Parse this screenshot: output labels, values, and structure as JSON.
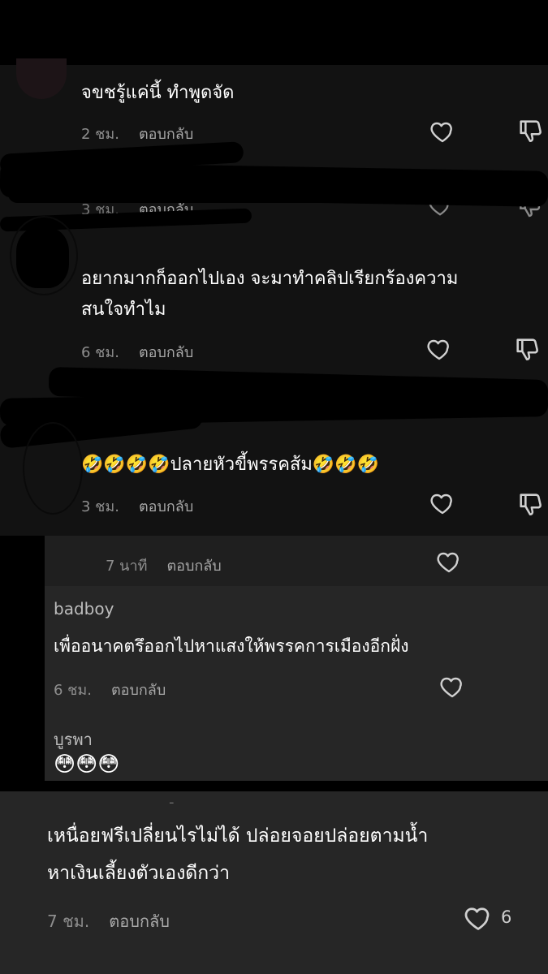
{
  "comments": [
    {
      "text": "จขชรู้แค่นี้ ทำพูดจัด",
      "time": "2 ชม.",
      "reply": "ตอบกลับ"
    },
    {
      "time": "3 ชม.",
      "reply": "ตอบกลับ"
    },
    {
      "lines": [
        "อยากมากก็ออกไปเอง จะมาทำคลิปเรียกร้องความ",
        "สนใจทำไม"
      ],
      "time": "6 ชม.",
      "reply": "ตอบกลับ"
    },
    {
      "text": "🤣🤣🤣🤣ปลายหัวขี้พรรคส้ม🤣🤣🤣",
      "time": "3 ชม.",
      "reply": "ตอบกลับ"
    }
  ],
  "reply_panel": {
    "time": "7 นาที",
    "reply": "ตอบกลับ"
  },
  "replies": [
    {
      "username": "badboy",
      "text": "เพื่ออนาคตรึออกไปหาแสงให้พรรคการเมืองอีกฝั่ง",
      "time": "6 ชม.",
      "reply": "ตอบกลับ"
    },
    {
      "username": "บูรพา",
      "text": "😳😳😳"
    }
  ],
  "bottom_comment": {
    "lines": [
      "เหนื่อยฟรีเปลี่ยนไรไม่ได้ ปล่อยจอยปล่อยตามน้ำ",
      "หาเงินเลี้ยงตัวเองดีกว่า"
    ],
    "time": "7 ชม.",
    "reply": "ตอบกลับ",
    "like_count": "6"
  },
  "icons": {
    "like": "heart-outline-icon",
    "dislike": "thumbs-down-icon"
  },
  "colors": {
    "background": "#121212",
    "panel": "#262626",
    "text": "#ffffff",
    "meta": "#8e8e8e"
  }
}
